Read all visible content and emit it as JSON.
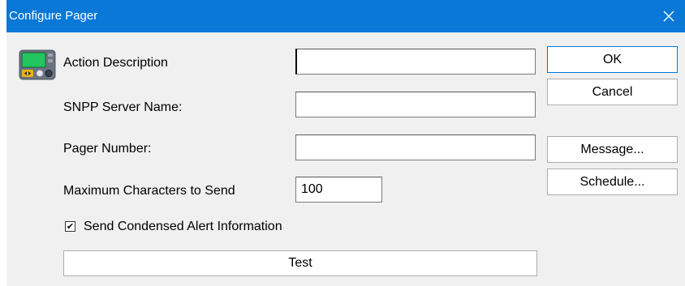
{
  "window": {
    "title": "Configure Pager",
    "close_glyph": "✕"
  },
  "icon": {
    "name": "pager-icon"
  },
  "form": {
    "action_description": {
      "label": "Action Description",
      "value": ""
    },
    "snpp_server": {
      "label": "SNPP Server Name:",
      "value": ""
    },
    "pager_number": {
      "label": "Pager Number:",
      "value": ""
    },
    "max_chars": {
      "label": "Maximum Characters to Send",
      "value": "100"
    },
    "condensed": {
      "label": "Send Condensed Alert Information",
      "checked": true,
      "check_glyph": "✔"
    }
  },
  "buttons": {
    "ok": "OK",
    "cancel": "Cancel",
    "message": "Message...",
    "schedule": "Schedule...",
    "test": "Test"
  },
  "colors": {
    "titlebar": "#0a78d7",
    "dialog_bg": "#f0f0f0"
  }
}
